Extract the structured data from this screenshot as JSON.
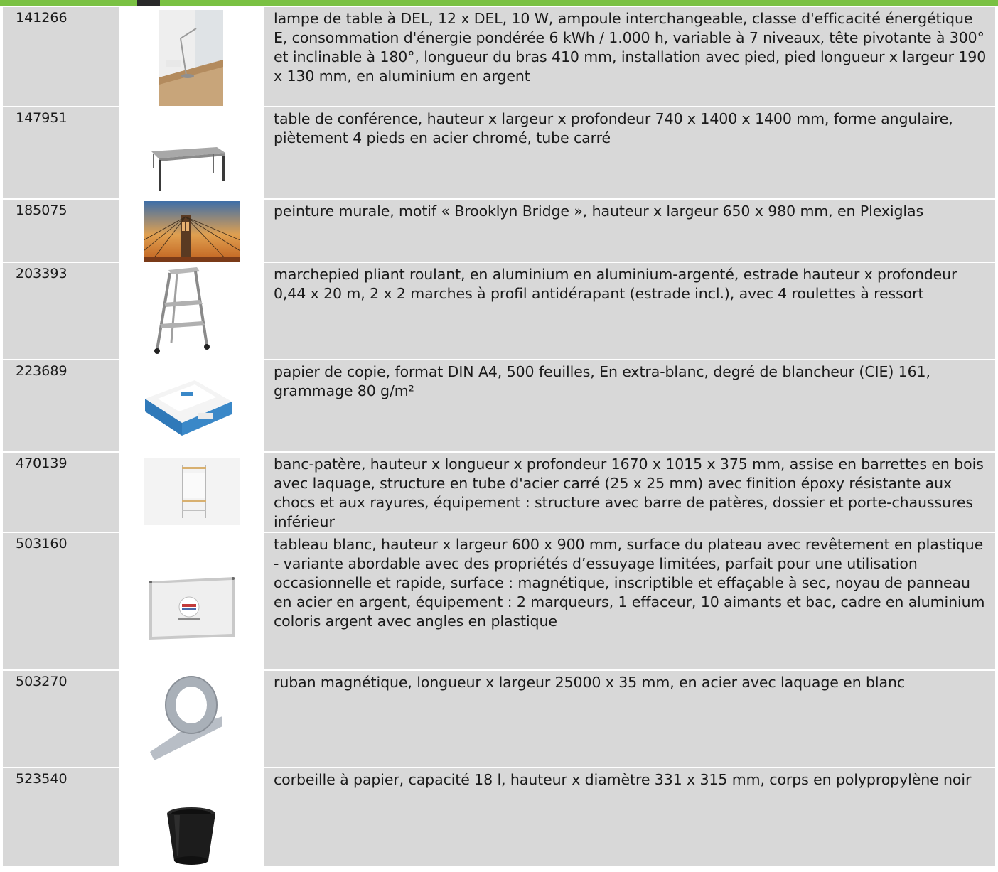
{
  "rows": [
    {
      "id": "141266",
      "image_name": "table-lamp-photo",
      "description": "lampe de table à DEL, 12 x DEL, 10 W, ampoule interchangeable, classe d'efficacité énergétique E, consommation d'énergie pondérée 6 kWh / 1.000 h, variable à 7 niveaux, tête pivotante à 300° et inclinable à 180°, longueur du bras 410 mm, installation avec pied, pied longueur x largeur 190 x 130 mm, en aluminium en argent"
    },
    {
      "id": "147951",
      "image_name": "conference-table-photo",
      "description": "table de conférence, hauteur x largeur x profondeur 740 x 1400 x 1400 mm, forme angulaire, piètement 4 pieds en acier chromé, tube carré"
    },
    {
      "id": "185075",
      "image_name": "brooklyn-bridge-painting-photo",
      "description": "peinture murale, motif « Brooklyn Bridge », hauteur x largeur 650 x 980 mm, en Plexiglas"
    },
    {
      "id": "203393",
      "image_name": "step-stool-photo",
      "description": "marchepied pliant roulant, en aluminium en aluminium-argenté, estrade hauteur x profondeur 0,44 x 20 m, 2 x 2 marches à profil antidérapant (estrade incl.), avec 4 roulettes à ressort"
    },
    {
      "id": "223689",
      "image_name": "copy-paper-box-photo",
      "description": "papier de copie, format DIN A4, 500 feuilles, En extra-blanc, degré de blancheur (CIE) 161, grammage 80 g/m²"
    },
    {
      "id": "470139",
      "image_name": "coat-bench-photo",
      "description": "banc-patère, hauteur x longueur x profondeur 1670 x 1015 x 375 mm, assise en barrettes en bois avec laquage, structure en tube d'acier carré (25 x 25 mm) avec finition époxy résistante aux chocs et aux rayures, équipement : structure avec barre de patères, dossier et porte-chaussures inférieur"
    },
    {
      "id": "503160",
      "image_name": "whiteboard-photo",
      "description": "tableau blanc, hauteur x largeur 600 x 900 mm, surface du plateau avec revêtement en plastique - variante abordable avec des propriétés d’essuyage limitées, parfait pour une utilisation occasionnelle et rapide, surface : magnétique, inscriptible et effaçable à sec, noyau de panneau en acier en argent, équipement : 2 marqueurs, 1 effaceur, 10 aimants et bac, cadre en aluminium coloris argent avec angles en plastique"
    },
    {
      "id": "503270",
      "image_name": "magnetic-tape-roll-photo",
      "description": "ruban magnétique, longueur x largeur 25000 x 35 mm, en acier avec laquage en blanc"
    },
    {
      "id": "523540",
      "image_name": "waste-bin-photo",
      "description": "corbeille à papier, capacité 18 l, hauteur x diamètre 331 x 315 mm, corps en polypropylène noir"
    }
  ]
}
